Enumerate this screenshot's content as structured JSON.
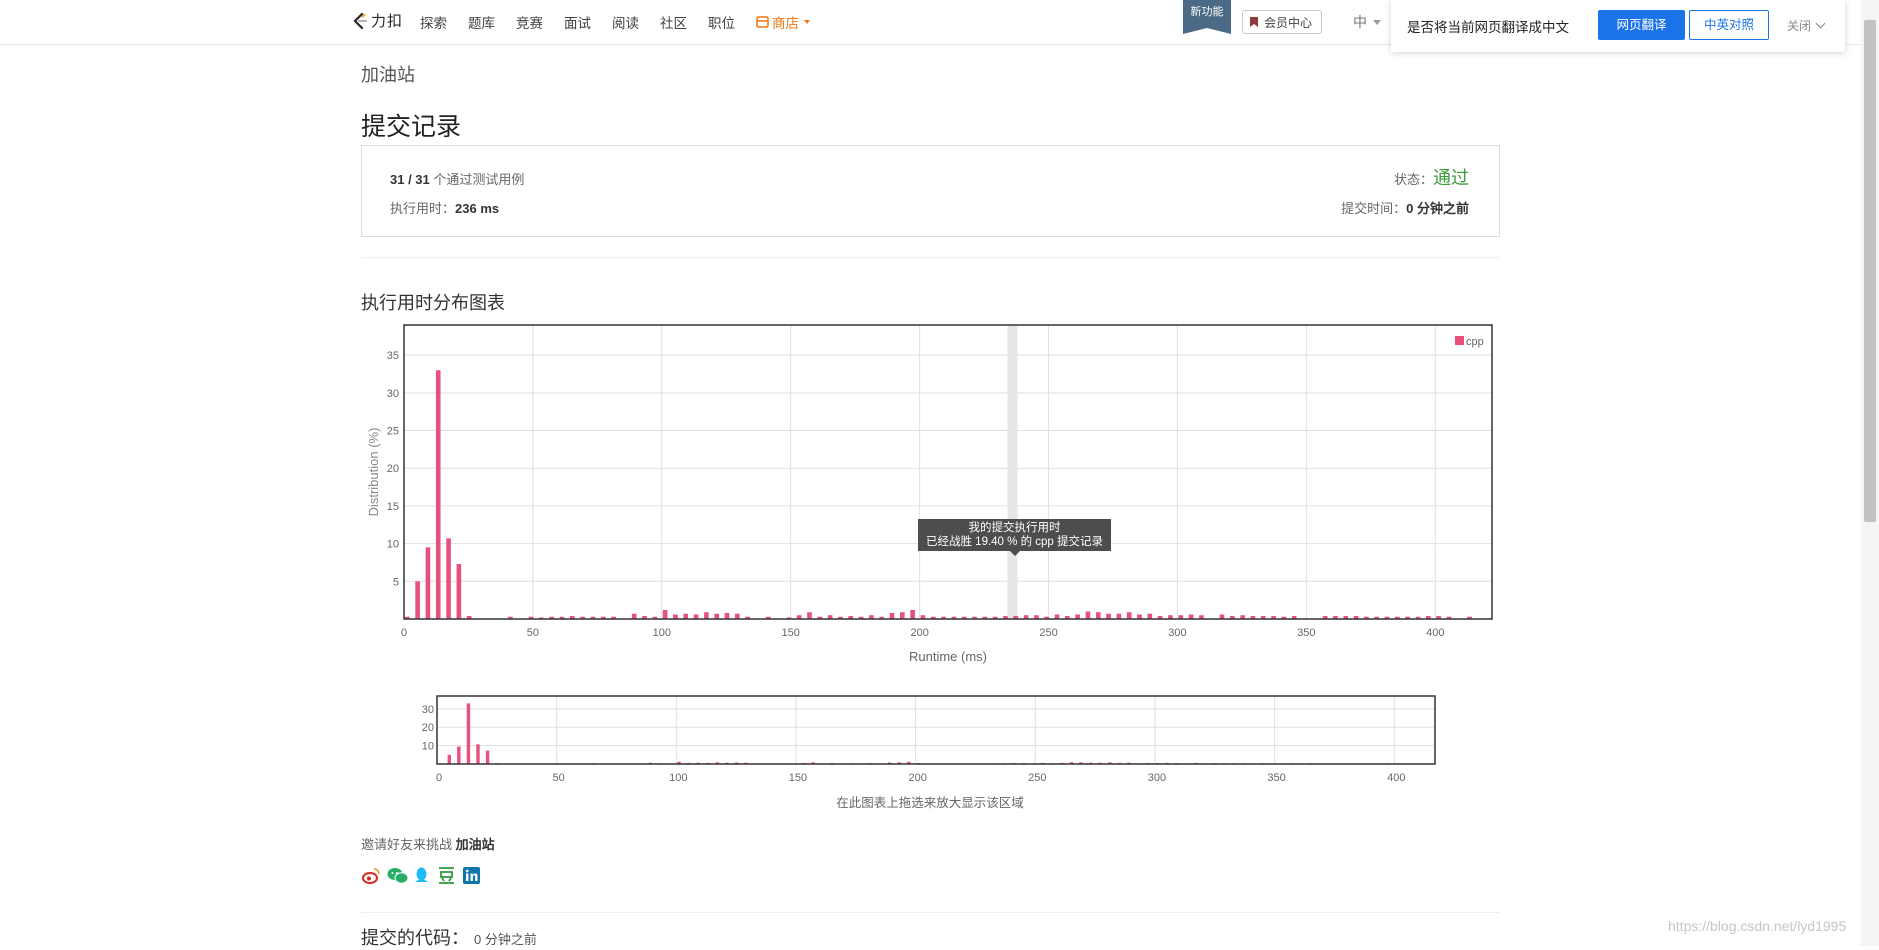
{
  "topbar": {
    "logo_text": "力扣",
    "nav": [
      "探索",
      "题库",
      "竞赛",
      "面试",
      "阅读",
      "社区",
      "职位"
    ],
    "store": "商店",
    "new_feature": "新功能",
    "member_center": "会员中心",
    "lang": "中"
  },
  "translate_bar": {
    "prompt": "是否将当前网页翻译成中文",
    "translate": "网页翻译",
    "bilingual": "中英对照",
    "close": "关闭"
  },
  "breadcrumb": "加油站",
  "page_title": "提交记录",
  "summary": {
    "passed": "31 / 31",
    "passed_suffix": " 个通过测试用例",
    "runtime_label": "执行用时：",
    "runtime_value": "236 ms",
    "status_label": "状态：",
    "status_value": "通过",
    "submit_time_label": "提交时间：",
    "submit_time_value": "0 分钟之前"
  },
  "chart_section_title": "执行用时分布图表",
  "tooltip": {
    "line1": "我的提交执行用时",
    "line2": "已经战胜 19.40 % 的 cpp 提交记录"
  },
  "nav_caption": "在此图表上拖选来放大显示该区域",
  "share": {
    "label": "邀请好友来挑战",
    "problem": "加油站",
    "icons": [
      "weibo-icon",
      "wechat-icon",
      "qq-icon",
      "douban-icon",
      "linkedin-icon"
    ]
  },
  "code": {
    "title": "提交的代码：",
    "time": "0 分钟之前"
  },
  "watermark": "https://blog.csdn.net/lyd1995",
  "colors": {
    "bar": "#e8507e",
    "highlight": "#e6e6e6",
    "status_ok": "#3a9d3a",
    "store": "#f0750f",
    "translate_primary": "#1a73e8"
  },
  "chart_data": {
    "type": "bar",
    "title": "",
    "xlabel": "Runtime (ms)",
    "ylabel": "Distribution (%)",
    "xlim": [
      0,
      422
    ],
    "ylim": [
      0,
      39
    ],
    "xticks": [
      0,
      50,
      100,
      150,
      200,
      250,
      300,
      350,
      400
    ],
    "yticks": [
      5,
      10,
      15,
      20,
      25,
      30,
      35
    ],
    "legend": "top-right",
    "grid": true,
    "highlight_x": 236,
    "series": [
      {
        "name": "cpp",
        "x": [
          0,
          4,
          8,
          12,
          16,
          20,
          24,
          40,
          48,
          52,
          56,
          60,
          64,
          68,
          72,
          76,
          80,
          88,
          92,
          96,
          100,
          104,
          108,
          112,
          116,
          120,
          124,
          128,
          132,
          140,
          148,
          152,
          156,
          160,
          164,
          168,
          172,
          176,
          180,
          184,
          188,
          192,
          196,
          200,
          204,
          208,
          212,
          216,
          220,
          224,
          228,
          232,
          236,
          240,
          244,
          248,
          252,
          256,
          260,
          264,
          268,
          272,
          276,
          280,
          284,
          288,
          292,
          296,
          300,
          304,
          308,
          316,
          320,
          324,
          328,
          332,
          336,
          340,
          344,
          356,
          360,
          364,
          368,
          372,
          376,
          380,
          384,
          388,
          392,
          396,
          400,
          404,
          412
        ],
        "values": [
          0.3,
          5,
          9.5,
          33,
          10.7,
          7.3,
          0.4,
          0.3,
          0.3,
          0.2,
          0.3,
          0.3,
          0.4,
          0.3,
          0.3,
          0.3,
          0.3,
          0.7,
          0.4,
          0.3,
          1.2,
          0.6,
          0.7,
          0.6,
          0.9,
          0.7,
          0.8,
          0.7,
          0.3,
          0.3,
          0.2,
          0.5,
          0.9,
          0.3,
          0.5,
          0.3,
          0.4,
          0.3,
          0.5,
          0.3,
          0.8,
          0.9,
          1.2,
          0.5,
          0.3,
          0.3,
          0.3,
          0.3,
          0.3,
          0.3,
          0.3,
          0.4,
          0.4,
          0.5,
          0.5,
          0.3,
          0.6,
          0.4,
          0.6,
          1.0,
          0.9,
          0.7,
          0.7,
          0.9,
          0.6,
          0.7,
          0.4,
          0.5,
          0.5,
          0.6,
          0.5,
          0.6,
          0.4,
          0.5,
          0.4,
          0.4,
          0.4,
          0.3,
          0.4,
          0.4,
          0.4,
          0.4,
          0.4,
          0.3,
          0.3,
          0.3,
          0.3,
          0.3,
          0.3,
          0.4,
          0.4,
          0.3,
          0.3
        ]
      }
    ],
    "navigator": {
      "yticks": [
        10,
        20,
        30
      ],
      "ylim": [
        0,
        37
      ],
      "xticks": [
        0,
        50,
        100,
        150,
        200,
        250,
        300,
        350,
        400
      ]
    }
  }
}
